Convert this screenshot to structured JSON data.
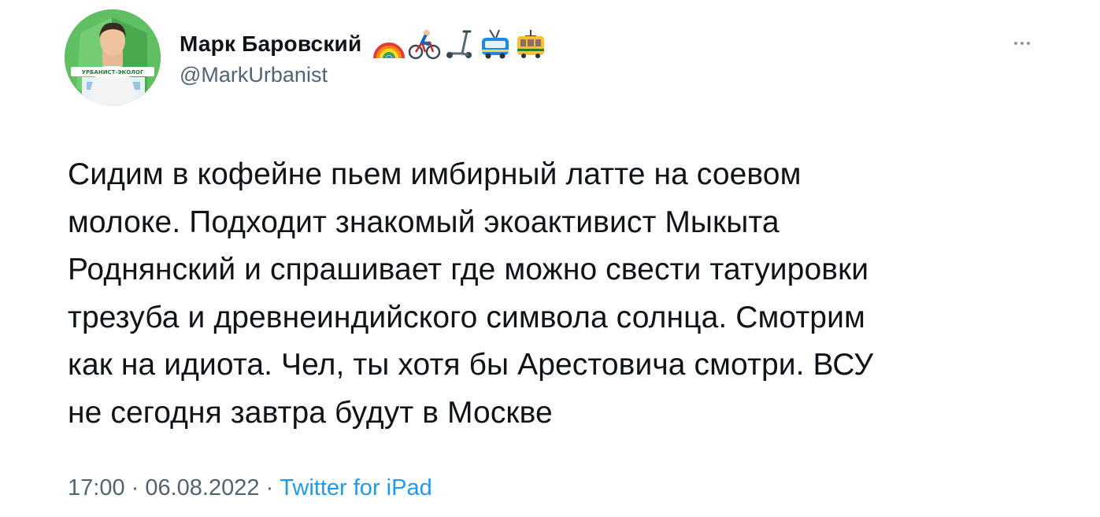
{
  "tweet": {
    "author": {
      "display_name": "Марк Баровский",
      "handle": "@MarkUrbanist",
      "name_emojis": [
        "rainbow-icon",
        "cyclist-icon",
        "scooter-icon",
        "trolleybus-icon",
        "tram-icon"
      ],
      "avatar_banner_text": "УРБАНИСТ-ЭКОЛОГ"
    },
    "more_button_icon": "ellipsis-icon",
    "text": "Сидим в кофейне пьем имбирный латте на соевом\nмолоке. Подходит знакомый экоактивист Мыкыта\nРоднянский и спрашивает где можно свести татуировки\nтрезуба и древнеиндийского символа солнца. Смотрим\nкак на идиота. Чел, ты хотя бы Арестовича смотри. ВСУ\nне сегодня завтра будут в Москве",
    "time": "17:00",
    "separator": " · ",
    "date": "06.08.2022",
    "source": "Twitter for iPad",
    "colors": {
      "text": "#0f1419",
      "secondary": "#536471",
      "link": "#1d9bf0",
      "avatar_bg": "#5fbf62"
    }
  }
}
